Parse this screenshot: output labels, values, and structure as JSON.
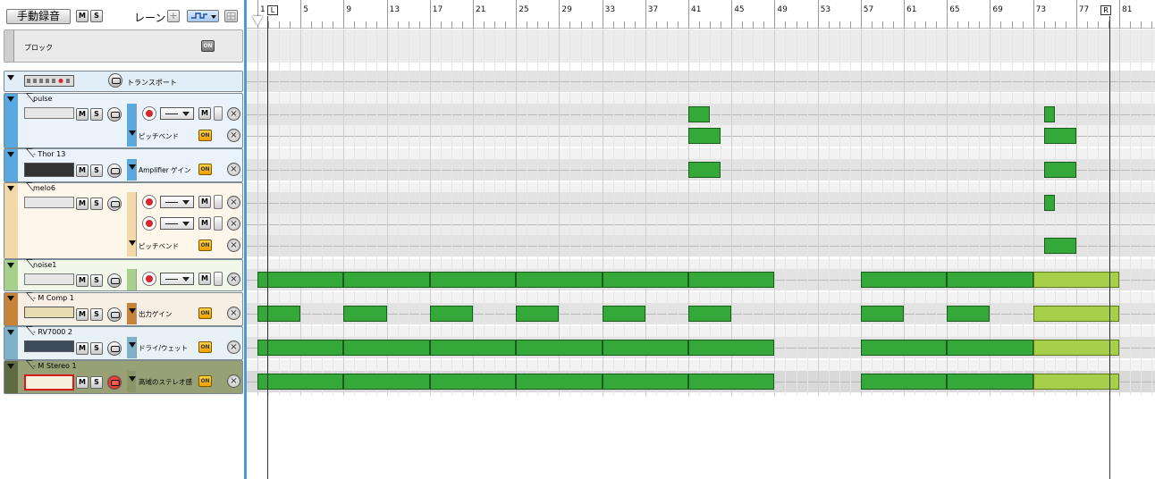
{
  "toolbar": {
    "manual_record_label": "手動録音",
    "mute_label": "M",
    "solo_label": "S",
    "lanes_label": "レーン",
    "add_lane_icon": "plus-icon",
    "automation_dropdown_icon": "automation-wave-icon",
    "grid_icon": "grid-icon"
  },
  "block_track": {
    "label": "ブロック",
    "on_label": "ON"
  },
  "transport_track": {
    "label": "トランスポート"
  },
  "tracks": [
    {
      "name": "pulse",
      "color": "#5aa8e0",
      "lanes": [
        "",
        "ピッチベンド"
      ]
    },
    {
      "name": "- Thor 13",
      "color": "#5aa8e0",
      "lanes": [
        "Amplifier ゲイン"
      ]
    },
    {
      "name": "melo6",
      "color": "#f3d9a8",
      "lanes": [
        "",
        "",
        "ピッチベンド"
      ]
    },
    {
      "name": "noise1",
      "color": "#a7d08a",
      "lanes": [
        ""
      ]
    },
    {
      "name": "- M Comp 1",
      "color": "#c78438",
      "lanes": [
        "出力ゲイン"
      ]
    },
    {
      "name": "- RV7000 2",
      "color": "#7eb2c9",
      "lanes": [
        "ドライ/ウェット"
      ]
    },
    {
      "name": "- M Stereo 1",
      "color": "#7c8a5a",
      "lanes": [
        "高域のステレオ感"
      ]
    }
  ],
  "common": {
    "m": "M",
    "s": "S",
    "on": "ON",
    "close": "×"
  },
  "ruler": {
    "bars": [
      "1",
      "5",
      "9",
      "13",
      "17",
      "21",
      "25",
      "29",
      "33",
      "37",
      "41",
      "45",
      "49",
      "53",
      "57",
      "61",
      "65",
      "69",
      "73",
      "77",
      "81"
    ],
    "left_locator": "L",
    "right_locator": "R"
  },
  "colors": {
    "clip": "#34a93a",
    "clip_selected": "#a8cf4a",
    "selection": "#4a9bd8"
  }
}
